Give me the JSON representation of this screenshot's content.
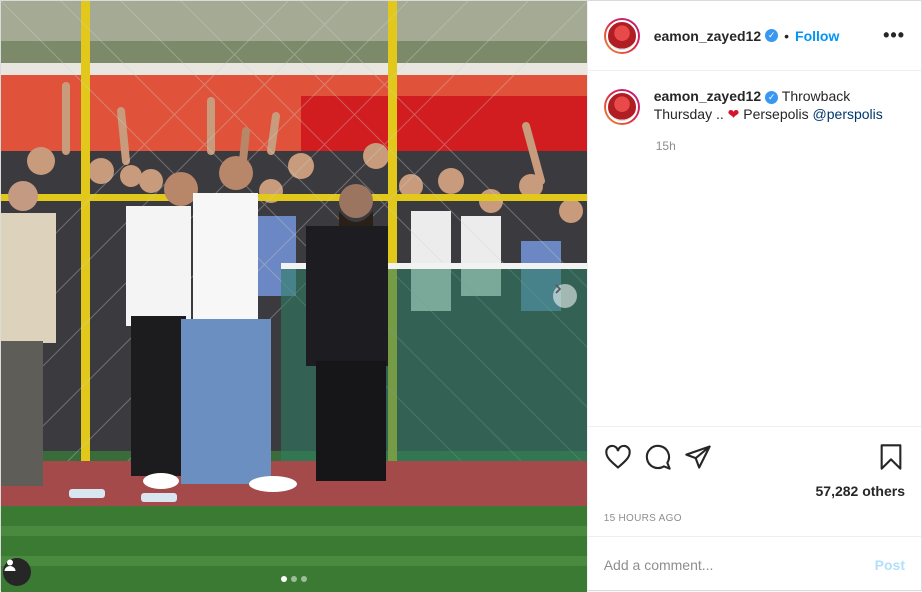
{
  "post": {
    "username": "eamon_zayed12",
    "follow_label": "Follow",
    "separator": "•",
    "more_label": "•••",
    "caption": {
      "username": "eamon_zayed12",
      "text_before": "Throwback Thursday ..",
      "emoji": "❤",
      "text_after": " Persepolis ",
      "mention": "@perspolis"
    },
    "caption_ago": "15h",
    "likes_text": "57,282 others",
    "timestamp": "15 HOURS AGO",
    "comment_placeholder": "Add a comment...",
    "post_label": "Post",
    "carousel": {
      "total": 3,
      "active": 1
    }
  },
  "icons": {
    "like": "heart-icon",
    "comment": "comment-icon",
    "share": "share-icon",
    "save": "bookmark-icon",
    "tag": "user-tag-icon",
    "verified": "verified-badge-icon"
  },
  "colors": {
    "accent": "#0095f6",
    "heart": "#d4152c",
    "verified": "#3897f0"
  }
}
